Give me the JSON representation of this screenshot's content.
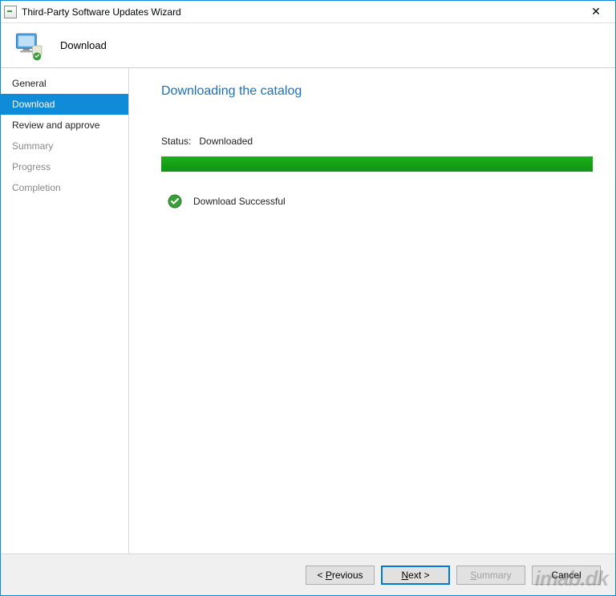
{
  "window": {
    "title": "Third-Party Software Updates Wizard"
  },
  "header": {
    "title": "Download"
  },
  "sidebar": {
    "items": [
      {
        "label": "General",
        "state": "done"
      },
      {
        "label": "Download",
        "state": "active"
      },
      {
        "label": "Review and approve",
        "state": "done"
      },
      {
        "label": "Summary",
        "state": "pending"
      },
      {
        "label": "Progress",
        "state": "pending"
      },
      {
        "label": "Completion",
        "state": "pending"
      }
    ]
  },
  "main": {
    "heading": "Downloading the catalog",
    "status_label": "Status:",
    "status_value": "Downloaded",
    "progress_percent": 100,
    "result_text": "Download Successful"
  },
  "footer": {
    "previous_label": "< Previous",
    "previous_mnemonic": "P",
    "next_label": "Next >",
    "next_mnemonic": "N",
    "summary_label": "Summary",
    "summary_mnemonic": "S",
    "summary_enabled": false,
    "cancel_label": "Cancel"
  },
  "watermark": "imab.dk"
}
